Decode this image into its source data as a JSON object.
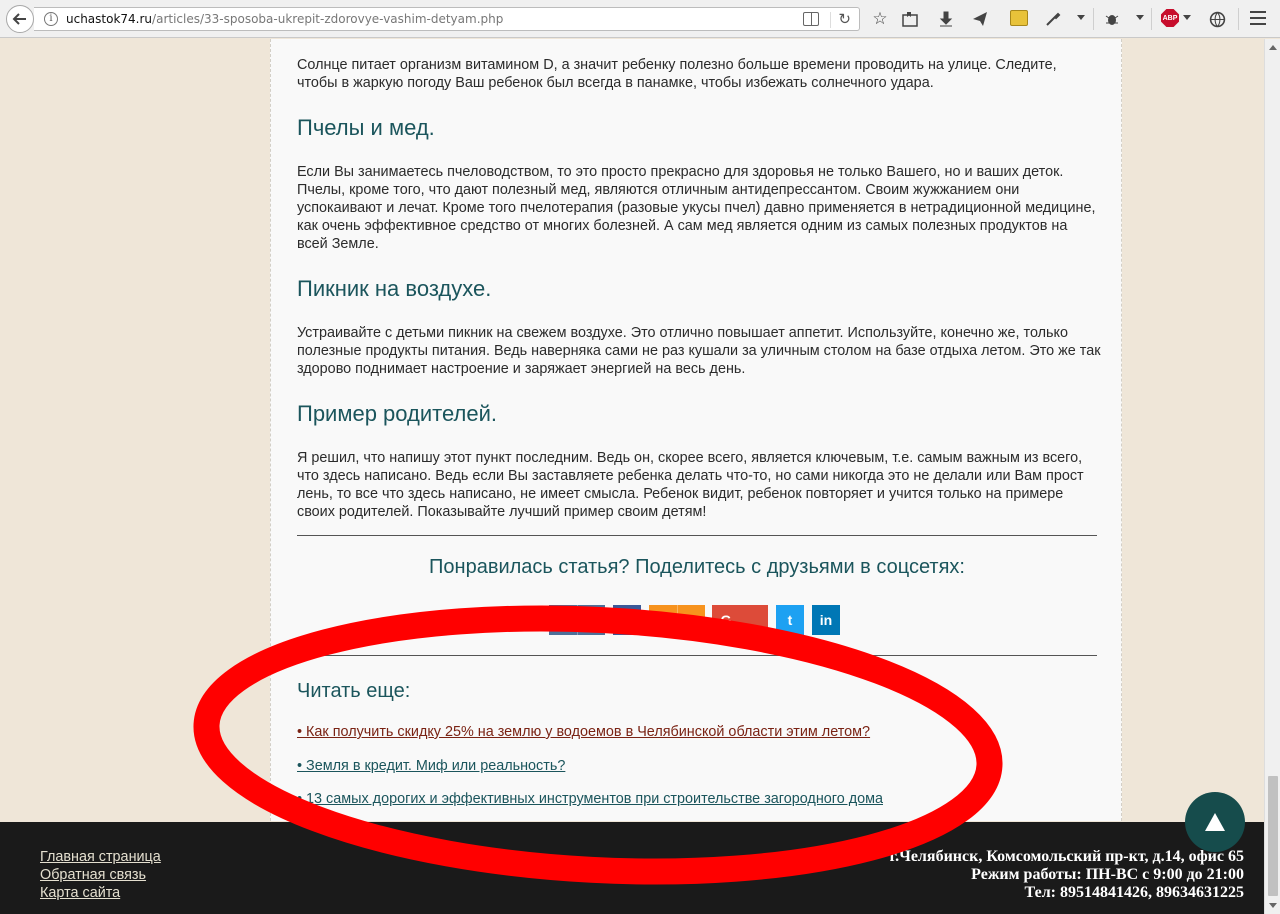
{
  "browser": {
    "url_host": "uchastok74.ru",
    "url_path": "/articles/33-sposoba-ukrepit-zdorovye-vashim-detyam.php",
    "abp_label": "ABP"
  },
  "article": {
    "intro": "Солнце питает организм витамином D, а значит ребенку полезно больше времени проводить на улице. Следите, чтобы в жаркую погоду Ваш ребенок был всегда в панамке, чтобы избежать солнечного удара.",
    "sections": [
      {
        "heading": "Пчелы и мед.",
        "text": "Если Вы занимаетесь пчеловодством, то это просто прекрасно для здоровья не только Вашего, но и ваших деток. Пчелы, кроме того, что дают полезный мед, являются отличным антидепрессантом. Своим жужжанием они успокаивают и лечат. Кроме того пчелотерапия (разовые укусы пчел) давно применяется в нетрадиционной медицине, как очень эффективное средство от многих болезней. А сам мед является одним из самых полезных продуктов на всей Земле."
      },
      {
        "heading": "Пикник на воздухе.",
        "text": "Устраивайте с детьми пикник на свежем воздухе. Это отлично повышает аппетит. Используйте, конечно же, только полезные продукты питания. Ведь наверняка сами не раз кушали за уличным столом на базе отдыха летом. Это же так здорово поднимает настроение и заряжает энергией на весь день."
      },
      {
        "heading": "Пример родителей.",
        "text": "Я решил, что напишу этот пункт последним. Ведь он, скорее всего, является ключевым, т.е. самым важным из всего, что здесь написано. Ведь если Вы заставляете ребенка делать что-то, но сами никогда это не делали или Вам прост лень, то все что здесь написано, не имеет смысла. Ребенок видит, ребенок повторяет и учится только на примере своих родителей. Показывайте лучший пример своим детям!"
      }
    ]
  },
  "share": {
    "title": "Понравилась статья? Поделитесь с друзьями в соцсетях:",
    "buttons": [
      {
        "network": "vk",
        "icon_text": "vk",
        "count": "8",
        "color": "#4e7099"
      },
      {
        "network": "facebook",
        "icon_text": "f",
        "count": "",
        "color": "#3b5998"
      },
      {
        "network": "odnoklassniki",
        "icon_text": "ok",
        "count": "2",
        "color": "#f7931e"
      },
      {
        "network": "google-plus",
        "icon_text": "G",
        "count": "",
        "color": "#dd4b39"
      },
      {
        "network": "twitter",
        "icon_text": "t",
        "count": "",
        "color": "#1da1f2"
      },
      {
        "network": "linkedin",
        "icon_text": "in",
        "count": "",
        "color": "#0077b5"
      }
    ]
  },
  "read_more": {
    "title": "Читать еще:",
    "links": [
      {
        "text": "• Как получить скидку 25% на землю у водоемов в Челябинской области этим летом?",
        "color": "#7a2314"
      },
      {
        "text": "• Земля в кредит. Миф или реальность?",
        "color": "#1b555c"
      },
      {
        "text": "• 13 самых дорогих и эффективных инструментов при строительстве загородного дома",
        "color": "#1b555c"
      }
    ]
  },
  "footer": {
    "links": [
      "Главная страница",
      "Обратная связь",
      "Карта сайта"
    ],
    "address": "г.Челябинск, Комсомольский пр-кт, д.14, офис 65",
    "hours": "Режим работы: ПН-ВС с 9:00 до 21:00",
    "phones": "Тел: 89514841426, 89634631225"
  },
  "colors": {
    "heading": "#1b555c",
    "annotation": "#ff0000",
    "footer_bg": "#1a1a1a"
  }
}
